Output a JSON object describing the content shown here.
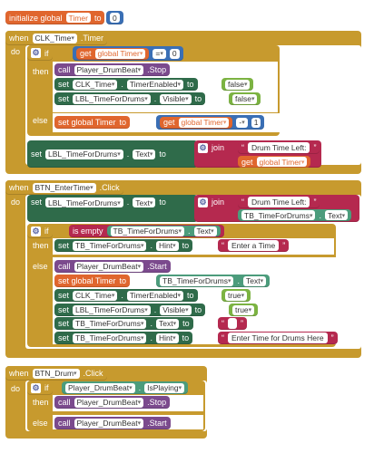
{
  "colors": {
    "event": "#c79a2e",
    "variable": "#e0662e",
    "component_setter": "#2f6b4a",
    "component_getter": "#3b9e57",
    "procedure_call": "#7b4a8d",
    "logic": "#7cb342",
    "math": "#3a6fb5",
    "text": "#b5294f"
  },
  "init": {
    "label": "initialize global",
    "name": "Timer",
    "to": "to",
    "value": "0"
  },
  "clk": {
    "when": "when",
    "component": "CLK_Time",
    "event": ".Timer",
    "do": "do",
    "if": "if",
    "then": "then",
    "else": "else",
    "get": "get",
    "global_timer": "global Timer",
    "eq": "=",
    "zero": "0",
    "call": "call",
    "player": "Player_DrumBeat",
    "stop": ".Stop",
    "set": "set",
    "clk_comp": "CLK_Time",
    "timer_enabled": "TimerEnabled",
    "to": "to",
    "false1": "false",
    "lbl": "LBL_TimeForDrums",
    "visible": "Visible",
    "false2": "false",
    "set_global": "set global Timer",
    "minus": "-",
    "one": "1",
    "text_prop": "Text",
    "join": "join",
    "str": "Drum Time Left: "
  },
  "enter": {
    "when": "when",
    "component": "BTN_EnterTime",
    "event": ".Click",
    "do": "do",
    "set": "set",
    "lbl": "LBL_TimeForDrums",
    "text_prop": "Text",
    "to": "to",
    "join": "join",
    "str": "Drum Time Left: ",
    "tb": "TB_TimeForDrums",
    "if": "if",
    "then": "then",
    "else": "else",
    "is_empty": "is empty",
    "hint": "Hint",
    "enter_time": "Enter a Time",
    "call": "call",
    "player": "Player_DrumBeat",
    "start": ".Start",
    "set_global": "set global Timer",
    "clk_comp": "CLK_Time",
    "timer_enabled": "TimerEnabled",
    "true1": "true",
    "visible": "Visible",
    "true2": "true",
    "empty": "",
    "enter_drums": "Enter Time for Drums Here"
  },
  "drum": {
    "when": "when",
    "component": "BTN_Drum",
    "event": ".Click",
    "do": "do",
    "if": "if",
    "then": "then",
    "else": "else",
    "player": "Player_DrumBeat",
    "is_playing": "IsPlaying",
    "call": "call",
    "stop": ".Stop",
    "start": ".Start"
  }
}
